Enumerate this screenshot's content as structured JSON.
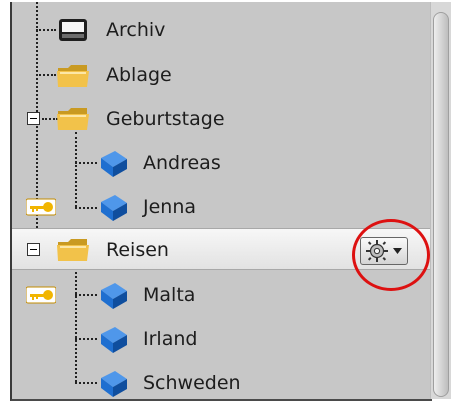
{
  "tree": {
    "items": [
      {
        "label": "Archiv",
        "icon": "archive-drive-icon"
      },
      {
        "label": "Ablage",
        "icon": "folder-icon"
      },
      {
        "label": "Geburtstage",
        "icon": "folder-icon",
        "expanded": true
      },
      {
        "label": "Andreas",
        "icon": "book-icon"
      },
      {
        "label": "Jenna",
        "icon": "book-icon",
        "locked": true
      },
      {
        "label": "Reisen",
        "icon": "folder-icon",
        "expanded": true,
        "selected": true
      },
      {
        "label": "Malta",
        "icon": "book-icon",
        "locked": true
      },
      {
        "label": "Irland",
        "icon": "book-icon"
      },
      {
        "label": "Schweden",
        "icon": "book-icon"
      }
    ]
  },
  "actions": {
    "gear_icon": "gear-icon",
    "dropdown_icon": "chevron-down-icon"
  },
  "colors": {
    "highlight_circle": "#dd1111",
    "folder": "#f2c24a",
    "book": "#1f6fd0",
    "key": "#f1b500"
  }
}
